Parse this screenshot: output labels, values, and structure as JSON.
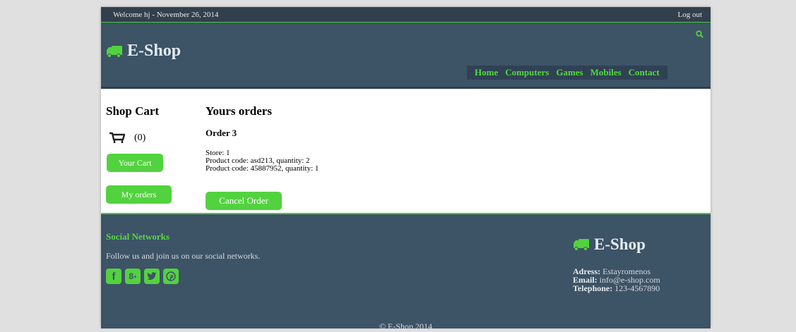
{
  "topbar": {
    "welcome": "Welcome hj -  November 26, 2014",
    "logout": "Log out"
  },
  "header": {
    "brand": "E-Shop",
    "nav": [
      "Home",
      "Computers",
      "Games",
      "Mobiles",
      "Contact"
    ]
  },
  "sidebar": {
    "title": "Shop Cart",
    "cart_count": "(0)",
    "your_cart": "Your Cart",
    "my_orders": "My orders"
  },
  "orders": {
    "title": "Yours orders",
    "order_name": "Order 3",
    "store": "Store: 1",
    "products": [
      "Product code: asd213, quantity: 2",
      "Product code: 45887952, quantity: 1"
    ],
    "cancel": "Cancel Order"
  },
  "footer": {
    "social_title": "Social Networks",
    "social_text": "Follow us and join us on our social networks.",
    "social_icons": [
      "facebook-icon",
      "google-plus-icon",
      "twitter-icon",
      "pinterest-icon"
    ],
    "brand": "E-Shop",
    "address_label": "Adress:",
    "address": " Estayromenos",
    "email_label": "Email:",
    "email": " info@e-shop.com",
    "phone_label": "Telephone:",
    "phone": " 123-4567890",
    "copyright": "© E-Shop 2014"
  },
  "colors": {
    "accent": "#53d23f",
    "header_bg": "#3d5366",
    "topbar_bg": "#323f4d",
    "page_bg": "#e0e0e0"
  }
}
